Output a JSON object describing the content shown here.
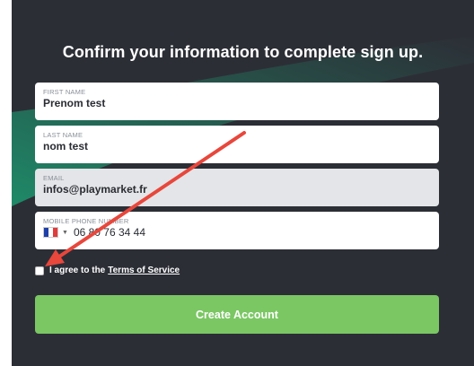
{
  "form": {
    "title": "Confirm your information to complete sign up.",
    "first_name": {
      "label": "FIRST NAME",
      "value": "Prenom test"
    },
    "last_name": {
      "label": "LAST NAME",
      "value": "nom test"
    },
    "email": {
      "label": "EMAIL",
      "value": "infos@playmarket.fr"
    },
    "mobile_phone": {
      "label": "MOBILE PHONE NUMBER",
      "value": "06 80 76 34 44",
      "country_flag": "france-flag-icon"
    },
    "agree_prefix": "I agree to the",
    "terms_link": "Terms of Service",
    "terms_checked": false,
    "create_button": "Create Account"
  },
  "colors": {
    "panel_bg": "#2c2e36",
    "accent_green": "#7ac763",
    "streak_green": "#1aa878",
    "annotation_arrow": "#e8473c"
  },
  "annotation": {
    "icon": "red-arrow-icon"
  }
}
